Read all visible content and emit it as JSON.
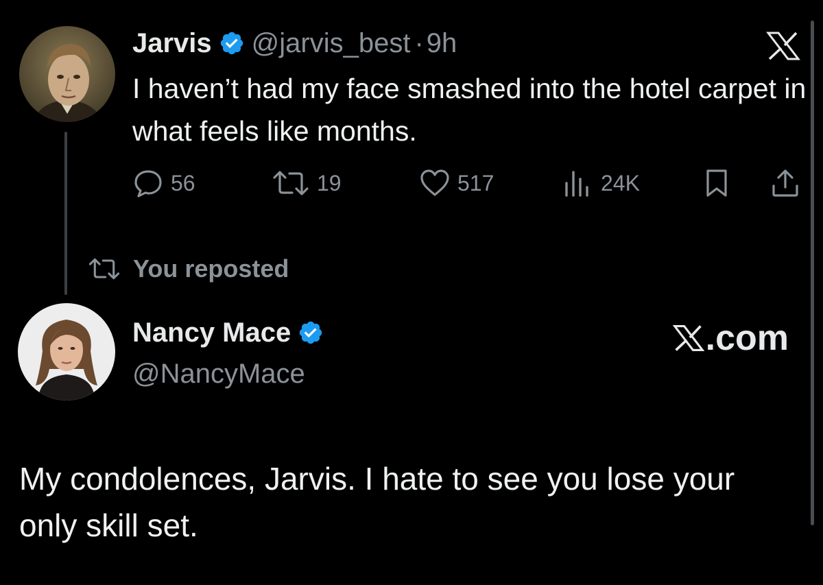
{
  "top_tweet": {
    "display_name": "Jarvis",
    "handle": "@jarvis_best",
    "separator": "·",
    "time": "9h",
    "text": "I haven’t had my face smashed into the hotel carpet in what feels like months.",
    "replies": "56",
    "reposts": "19",
    "likes": "517",
    "views": "24K"
  },
  "repost_label": "You reposted",
  "reposted_tweet": {
    "display_name": "Nancy Mace",
    "handle": "@NancyMace",
    "source_label": ".com",
    "text": "My condolences, Jarvis. I hate to see you lose your only skill set."
  },
  "colors": {
    "background": "#000000",
    "text": "#e7e9ea",
    "muted": "#8b9298",
    "verified": "#1d9bf0"
  },
  "icons": {
    "verified": "verified-badge-icon",
    "x_logo": "x-logo-icon",
    "reply": "comment-bubble-icon",
    "repost": "repost-arrows-icon",
    "like": "heart-icon",
    "views": "bar-chart-icon",
    "bookmark": "bookmark-icon",
    "share": "share-upload-icon"
  }
}
